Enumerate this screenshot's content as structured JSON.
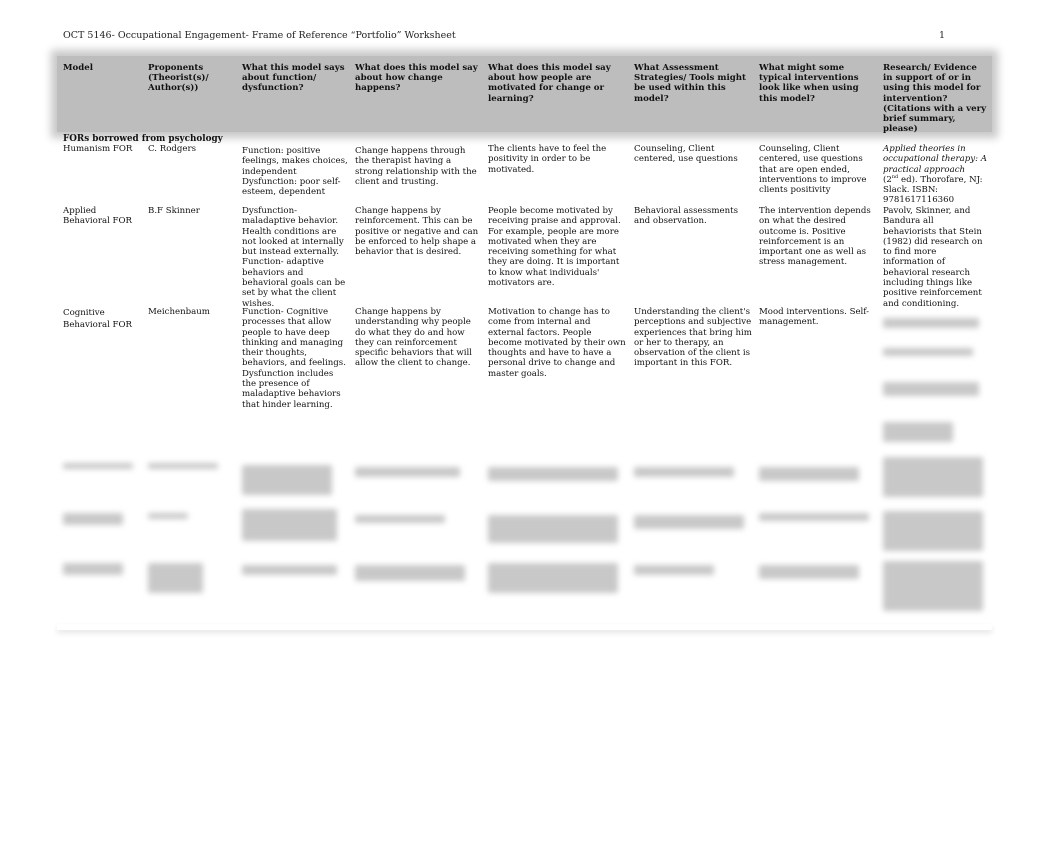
{
  "document": {
    "running_header": "OCT 5146- Occupational Engagement- Frame of Reference “Portfolio” Worksheet",
    "page_number": "1"
  },
  "table": {
    "headers": [
      "Model",
      "Proponents (Theorist(s)/ Author(s))",
      "What this model says about function/ dysfunction?",
      "What does this model say about how change happens?",
      "What does this model say about how people are motivated for change or learning?",
      "What Assessment Strategies/ Tools might be used within this model?",
      "What might some typical interventions look like when using this model?",
      "Research/ Evidence in support of or in using this model for intervention? (Citations with a very brief summary, please)"
    ],
    "section_label": "FORs borrowed from psychology",
    "rows": [
      {
        "model": "Humanism FOR",
        "proponents": "C. Rodgers",
        "function": "Function: positive feelings, makes choices, independent Dysfunction: poor self-esteem, dependent",
        "change": "Change happens through the therapist having a strong relationship with the client and trusting.",
        "motivation": "The clients have to feel the positivity in order to be motivated.",
        "assessment": "Counseling, Client centered, use questions",
        "interventions": "Counseling, Client centered, use questions that are open ended, interventions to improve clients positivity",
        "research_italic": "Applied theories in occupational therapy: A practical approach",
        "research_edition_num": "2",
        "research_edition_sup": "nd",
        "research_rest": " ed). Thorofare, NJ: Slack. ISBN: 9781617116360"
      },
      {
        "model": "Applied Behavioral FOR",
        "proponents": "B.F Skinner",
        "function": "Dysfunction- maladaptive behavior. Health conditions are not looked at internally but instead externally. Function- adaptive behaviors and behavioral goals can be set by what the client wishes.",
        "change": "Change happens by reinforcement. This can be positive or negative and can be enforced to help shape a behavior that is desired.",
        "motivation": "People become motivated by receiving praise and approval. For example, people are more motivated when they are receiving something for what they are doing. It is important to know what individuals' motivators are.",
        "assessment": "Behavioral assessments and observation.",
        "interventions": "The intervention depends on what the desired outcome is. Positive reinforcement is an important one as well as stress management.",
        "research": "Pavolv, Skinner, and Bandura all behaviorists that Stein (1982) did research on to find more information of behavioral research including things like positive reinforcement and conditioning."
      },
      {
        "model": "Cognitive Behavioral FOR",
        "proponents": "Meichenbaum",
        "function": "Function- Cognitive processes that allow people to have deep thinking and managing their thoughts, behaviors, and feelings. Dysfunction includes the presence of maladaptive behaviors that hinder learning.",
        "change": "Change happens by understanding why people do what they do and how they can reinforcement specific behaviors that will allow the client to change.",
        "motivation": "Motivation to change has to come from internal and external factors. People become motivated by their own thoughts and have to have a personal drive to change and master goals.",
        "assessment": "Understanding the client's perceptions and subjective experiences that bring him or her to therapy, an observation of the client is important in this FOR.",
        "interventions": "Mood interventions. Self-management.",
        "research": ""
      }
    ]
  }
}
